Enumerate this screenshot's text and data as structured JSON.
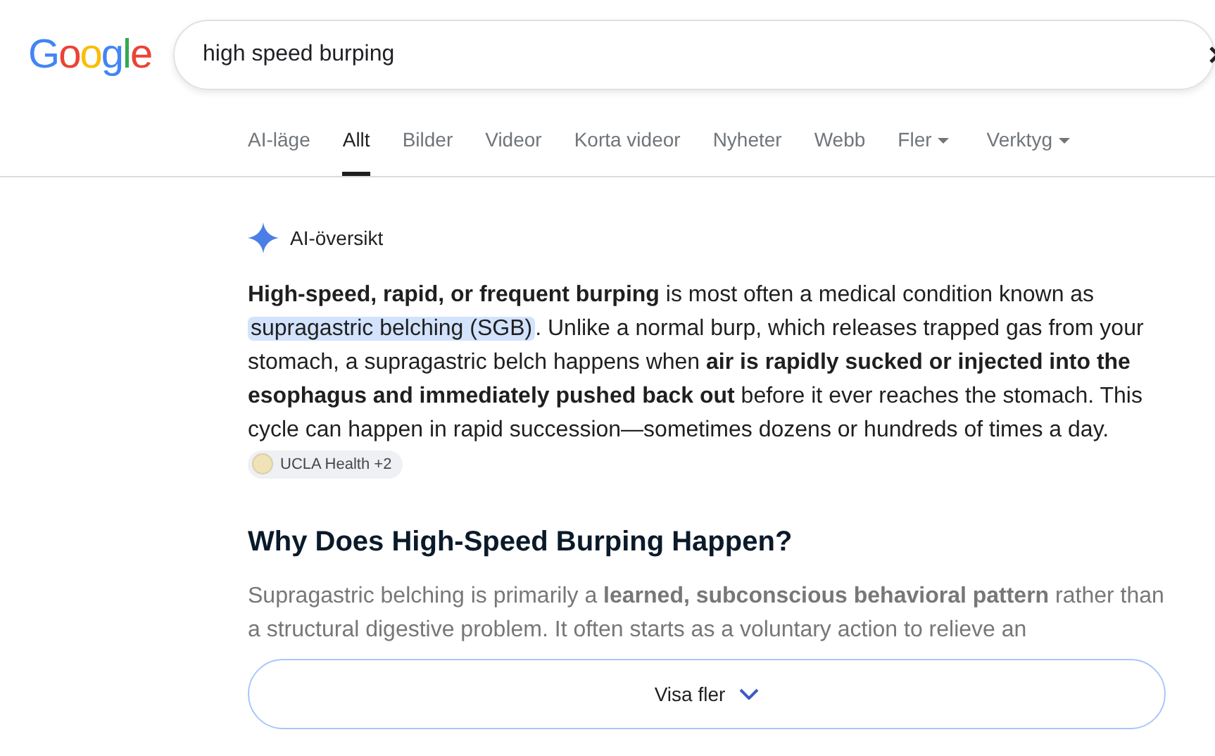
{
  "logo": {
    "letters": [
      {
        "char": "G",
        "color": "#4285f4"
      },
      {
        "char": "o",
        "color": "#ea4335"
      },
      {
        "char": "o",
        "color": "#fbbc05"
      },
      {
        "char": "g",
        "color": "#4285f4"
      },
      {
        "char": "l",
        "color": "#34a853"
      },
      {
        "char": "e",
        "color": "#ea4335"
      }
    ]
  },
  "search": {
    "value": "high speed burping"
  },
  "tabs": [
    {
      "label": "AI-läge",
      "selected": false,
      "dropdown": false
    },
    {
      "label": "Allt",
      "selected": true,
      "dropdown": false
    },
    {
      "label": "Bilder",
      "selected": false,
      "dropdown": false
    },
    {
      "label": "Videor",
      "selected": false,
      "dropdown": false
    },
    {
      "label": "Korta videor",
      "selected": false,
      "dropdown": false
    },
    {
      "label": "Nyheter",
      "selected": false,
      "dropdown": false
    },
    {
      "label": "Webb",
      "selected": false,
      "dropdown": false
    },
    {
      "label": "Fler",
      "selected": false,
      "dropdown": true
    },
    {
      "label": "Verktyg",
      "selected": false,
      "dropdown": true
    }
  ],
  "overview": {
    "label": "AI-översikt",
    "paragraph": [
      {
        "kind": "bold",
        "text": "High-speed, rapid, or frequent burping"
      },
      {
        "kind": "text",
        "text": " is most often a medical condition known as "
      },
      {
        "kind": "highlight",
        "text": "supragastric belching (SGB)"
      },
      {
        "kind": "text",
        "text": ". Unlike a normal burp, which releases trapped gas from your stomach, a supragastric belch happens when "
      },
      {
        "kind": "bold",
        "text": "air is rapidly sucked or injected into the esophagus and immediately pushed back out"
      },
      {
        "kind": "text",
        "text": " before it ever reaches the stomach. This cycle can happen in rapid succession—sometimes dozens or hundreds of times a day."
      }
    ],
    "source": "UCLA Health +2",
    "heading": "Why Does High-Speed Burping Happen?",
    "faded_paragraph": "Supragastric belching is primarily a **learned, subconscious behavioral pattern** rather than a structural digestive problem. It often starts as a voluntary action to relieve an",
    "more_button": "Visa fler"
  }
}
